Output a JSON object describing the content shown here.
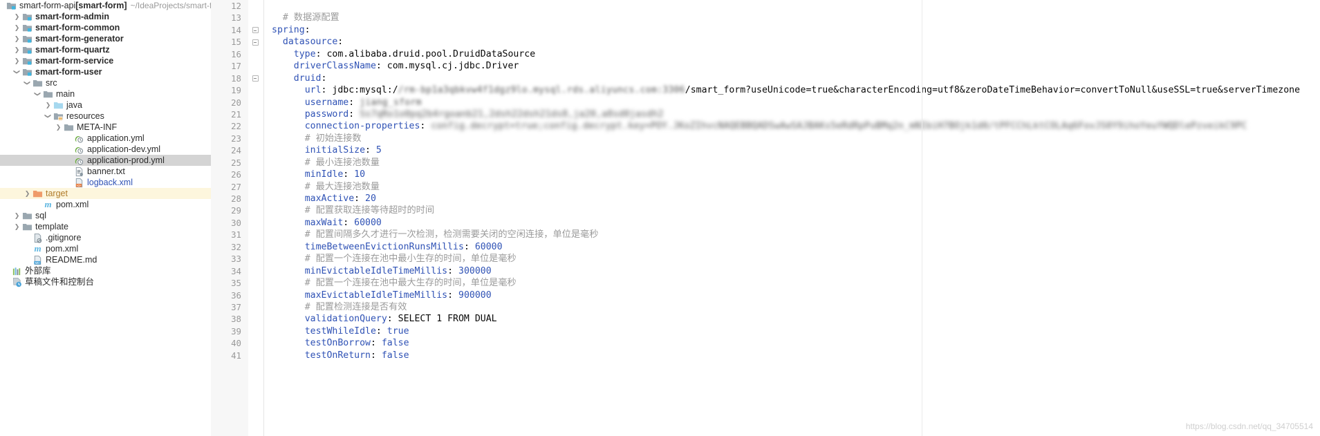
{
  "window": {
    "app": "IntelliJ IDEA",
    "active_file": "application-prod.yml"
  },
  "sidebar": {
    "root": {
      "name": "smart-form-api",
      "module": "[smart-form]",
      "path": "~/IdeaProjects/smart-form-"
    },
    "items": [
      {
        "label": "smart-form-admin",
        "indent": 1,
        "arrow": "collapsed",
        "icon": "module-folder-icon",
        "style": "bold",
        "state": "normal"
      },
      {
        "label": "smart-form-common",
        "indent": 1,
        "arrow": "collapsed",
        "icon": "module-folder-icon",
        "style": "bold",
        "state": "normal"
      },
      {
        "label": "smart-form-generator",
        "indent": 1,
        "arrow": "collapsed",
        "icon": "module-folder-icon",
        "style": "bold",
        "state": "normal"
      },
      {
        "label": "smart-form-quartz",
        "indent": 1,
        "arrow": "collapsed",
        "icon": "module-folder-icon",
        "style": "bold",
        "state": "normal"
      },
      {
        "label": "smart-form-service",
        "indent": 1,
        "arrow": "collapsed",
        "icon": "module-folder-icon",
        "style": "bold",
        "state": "normal"
      },
      {
        "label": "smart-form-user",
        "indent": 1,
        "arrow": "expanded",
        "icon": "module-folder-icon",
        "style": "bold",
        "state": "normal"
      },
      {
        "label": "src",
        "indent": 2,
        "arrow": "expanded",
        "icon": "folder-icon",
        "style": "normal",
        "state": "normal"
      },
      {
        "label": "main",
        "indent": 3,
        "arrow": "expanded",
        "icon": "folder-icon",
        "style": "normal",
        "state": "normal"
      },
      {
        "label": "java",
        "indent": 4,
        "arrow": "collapsed",
        "icon": "source-folder-icon",
        "style": "normal",
        "state": "normal"
      },
      {
        "label": "resources",
        "indent": 4,
        "arrow": "expanded",
        "icon": "resource-folder-icon",
        "style": "normal",
        "state": "normal"
      },
      {
        "label": "META-INF",
        "indent": 5,
        "arrow": "collapsed",
        "icon": "folder-icon",
        "style": "normal",
        "state": "normal"
      },
      {
        "label": "application.yml",
        "indent": 6,
        "arrow": "none",
        "icon": "spring-yaml-icon",
        "style": "normal",
        "state": "normal"
      },
      {
        "label": "application-dev.yml",
        "indent": 6,
        "arrow": "none",
        "icon": "spring-yaml-icon",
        "style": "normal",
        "state": "normal"
      },
      {
        "label": "application-prod.yml",
        "indent": 6,
        "arrow": "none",
        "icon": "spring-yaml-icon",
        "style": "normal",
        "state": "selected"
      },
      {
        "label": "banner.txt",
        "indent": 6,
        "arrow": "none",
        "icon": "text-file-icon",
        "style": "normal",
        "state": "normal"
      },
      {
        "label": "logback.xml",
        "indent": 6,
        "arrow": "none",
        "icon": "xml-file-icon",
        "style": "link",
        "state": "normal"
      },
      {
        "label": "target",
        "indent": 2,
        "arrow": "collapsed",
        "icon": "excluded-folder-icon",
        "style": "orange",
        "state": "highlight"
      },
      {
        "label": "pom.xml",
        "indent": 3,
        "arrow": "none",
        "icon": "maven-icon",
        "style": "normal",
        "state": "normal"
      },
      {
        "label": "sql",
        "indent": 1,
        "arrow": "collapsed",
        "icon": "folder-icon",
        "style": "normal",
        "state": "normal"
      },
      {
        "label": "template",
        "indent": 1,
        "arrow": "collapsed",
        "icon": "folder-icon",
        "style": "normal",
        "state": "normal"
      },
      {
        "label": ".gitignore",
        "indent": 2,
        "arrow": "none",
        "icon": "gitignore-icon",
        "style": "normal",
        "state": "normal"
      },
      {
        "label": "pom.xml",
        "indent": 2,
        "arrow": "none",
        "icon": "maven-icon",
        "style": "normal",
        "state": "normal"
      },
      {
        "label": "README.md",
        "indent": 2,
        "arrow": "none",
        "icon": "markdown-icon",
        "style": "normal",
        "state": "normal"
      },
      {
        "label": "外部库",
        "indent": 0,
        "arrow": "none",
        "icon": "external-libraries-icon",
        "style": "normal",
        "state": "normal"
      },
      {
        "label": "草稿文件和控制台",
        "indent": 0,
        "arrow": "none",
        "icon": "scratches-icon",
        "style": "normal",
        "state": "normal"
      }
    ]
  },
  "editor": {
    "watermark": "https://blog.csdn.net/qq_34705514",
    "lines": [
      {
        "n": "12",
        "fold": false,
        "indent": 0,
        "tokens": []
      },
      {
        "n": "13",
        "fold": false,
        "indent": 1,
        "tokens": [
          {
            "t": "comment",
            "v": "# 数据源配置"
          }
        ]
      },
      {
        "n": "14",
        "fold": true,
        "indent": 0,
        "tokens": [
          {
            "t": "key",
            "v": "spring"
          },
          {
            "t": "plain",
            "v": ":"
          }
        ]
      },
      {
        "n": "15",
        "fold": true,
        "indent": 1,
        "tokens": [
          {
            "t": "key",
            "v": "datasource"
          },
          {
            "t": "plain",
            "v": ":"
          }
        ]
      },
      {
        "n": "16",
        "fold": false,
        "indent": 2,
        "tokens": [
          {
            "t": "key",
            "v": "type"
          },
          {
            "t": "plain",
            "v": ": com.alibaba.druid.pool.DruidDataSource"
          }
        ]
      },
      {
        "n": "17",
        "fold": false,
        "indent": 2,
        "tokens": [
          {
            "t": "key",
            "v": "driverClassName"
          },
          {
            "t": "plain",
            "v": ": com.mysql.cj.jdbc.Driver"
          }
        ]
      },
      {
        "n": "18",
        "fold": true,
        "indent": 2,
        "tokens": [
          {
            "t": "key",
            "v": "druid"
          },
          {
            "t": "plain",
            "v": ":"
          }
        ]
      },
      {
        "n": "19",
        "fold": false,
        "indent": 3,
        "tokens": [
          {
            "t": "key",
            "v": "url"
          },
          {
            "t": "plain",
            "v": ": jdbc:mysql:/"
          },
          {
            "t": "blur",
            "v": "/rm-bp1a3qbkvw4f1dgz9lo.mysql.rds.aliyuncs.com:3306"
          },
          {
            "t": "plain",
            "v": "/smart_form?useUnicode=true&characterEncoding=utf8&zeroDateTimeBehavior=convertToNull&useSSL=true&serverTimezone"
          }
        ]
      },
      {
        "n": "20",
        "fold": false,
        "indent": 3,
        "tokens": [
          {
            "t": "key",
            "v": "username"
          },
          {
            "t": "plain",
            "v": ": "
          },
          {
            "t": "blur",
            "v": "jiang_sform"
          }
        ]
      },
      {
        "n": "21",
        "fold": false,
        "indent": 3,
        "tokens": [
          {
            "t": "key",
            "v": "password"
          },
          {
            "t": "plain",
            "v": ": "
          },
          {
            "t": "blur2",
            "v": "Ss7qRo1o0pq2b4rgoanb21,2dsh22dsh21ds8,ja20,a8sd0jasdh2"
          }
        ]
      },
      {
        "n": "22",
        "fold": false,
        "indent": 3,
        "tokens": [
          {
            "t": "key",
            "v": "connection-properties"
          },
          {
            "t": "plain",
            "v": ": "
          },
          {
            "t": "blur2",
            "v": "config.decrypt=true;config.decrypt.key=POY.JKoZIhvcNAQEBBQADSwAwSAJBAKs5eRdRpPuBMq2n_mNIbiH7BOjk1d0/tPFCChLktCOLAq6FovJS0Y9ihoYeuYWQDlePzveikC9PC"
          }
        ]
      },
      {
        "n": "23",
        "fold": false,
        "indent": 3,
        "tokens": [
          {
            "t": "comment",
            "v": "# 初始连接数"
          }
        ]
      },
      {
        "n": "24",
        "fold": false,
        "indent": 3,
        "tokens": [
          {
            "t": "key",
            "v": "initialSize"
          },
          {
            "t": "plain",
            "v": ": "
          },
          {
            "t": "number",
            "v": "5"
          }
        ]
      },
      {
        "n": "25",
        "fold": false,
        "indent": 3,
        "tokens": [
          {
            "t": "comment",
            "v": "# 最小连接池数量"
          }
        ]
      },
      {
        "n": "26",
        "fold": false,
        "indent": 3,
        "tokens": [
          {
            "t": "key",
            "v": "minIdle"
          },
          {
            "t": "plain",
            "v": ": "
          },
          {
            "t": "number",
            "v": "10"
          }
        ]
      },
      {
        "n": "27",
        "fold": false,
        "indent": 3,
        "tokens": [
          {
            "t": "comment",
            "v": "# 最大连接池数量"
          }
        ]
      },
      {
        "n": "28",
        "fold": false,
        "indent": 3,
        "tokens": [
          {
            "t": "key",
            "v": "maxActive"
          },
          {
            "t": "plain",
            "v": ": "
          },
          {
            "t": "number",
            "v": "20"
          }
        ]
      },
      {
        "n": "29",
        "fold": false,
        "indent": 3,
        "tokens": [
          {
            "t": "comment",
            "v": "# 配置获取连接等待超时的时间"
          }
        ]
      },
      {
        "n": "30",
        "fold": false,
        "indent": 3,
        "tokens": [
          {
            "t": "key",
            "v": "maxWait"
          },
          {
            "t": "plain",
            "v": ": "
          },
          {
            "t": "number",
            "v": "60000"
          }
        ]
      },
      {
        "n": "31",
        "fold": false,
        "indent": 3,
        "tokens": [
          {
            "t": "comment",
            "v": "# 配置间隔多久才进行一次检测，检测需要关闭的空闲连接，单位是毫秒"
          }
        ]
      },
      {
        "n": "32",
        "fold": false,
        "indent": 3,
        "tokens": [
          {
            "t": "key",
            "v": "timeBetweenEvictionRunsMillis"
          },
          {
            "t": "plain",
            "v": ": "
          },
          {
            "t": "number",
            "v": "60000"
          }
        ]
      },
      {
        "n": "33",
        "fold": false,
        "indent": 3,
        "tokens": [
          {
            "t": "comment",
            "v": "# 配置一个连接在池中最小生存的时间，单位是毫秒"
          }
        ]
      },
      {
        "n": "34",
        "fold": false,
        "indent": 3,
        "tokens": [
          {
            "t": "key",
            "v": "minEvictableIdleTimeMillis"
          },
          {
            "t": "plain",
            "v": ": "
          },
          {
            "t": "number",
            "v": "300000"
          }
        ]
      },
      {
        "n": "35",
        "fold": false,
        "indent": 3,
        "tokens": [
          {
            "t": "comment",
            "v": "# 配置一个连接在池中最大生存的时间，单位是毫秒"
          }
        ]
      },
      {
        "n": "36",
        "fold": false,
        "indent": 3,
        "tokens": [
          {
            "t": "key",
            "v": "maxEvictableIdleTimeMillis"
          },
          {
            "t": "plain",
            "v": ": "
          },
          {
            "t": "number",
            "v": "900000"
          }
        ]
      },
      {
        "n": "37",
        "fold": false,
        "indent": 3,
        "tokens": [
          {
            "t": "comment",
            "v": "# 配置检测连接是否有效"
          }
        ]
      },
      {
        "n": "38",
        "fold": false,
        "indent": 3,
        "tokens": [
          {
            "t": "key",
            "v": "validationQuery"
          },
          {
            "t": "plain",
            "v": ": SELECT 1 FROM DUAL"
          }
        ]
      },
      {
        "n": "39",
        "fold": false,
        "indent": 3,
        "tokens": [
          {
            "t": "key",
            "v": "testWhileIdle"
          },
          {
            "t": "plain",
            "v": ": "
          },
          {
            "t": "number",
            "v": "true"
          }
        ]
      },
      {
        "n": "40",
        "fold": false,
        "indent": 3,
        "tokens": [
          {
            "t": "key",
            "v": "testOnBorrow"
          },
          {
            "t": "plain",
            "v": ": "
          },
          {
            "t": "number",
            "v": "false"
          }
        ]
      },
      {
        "n": "41",
        "fold": false,
        "indent": 3,
        "tokens": [
          {
            "t": "key",
            "v": "testOnReturn"
          },
          {
            "t": "plain",
            "v": ": "
          },
          {
            "t": "number",
            "v": "false"
          }
        ]
      }
    ]
  },
  "colors": {
    "key": "#2f52b5",
    "comment": "#9b9b9b",
    "selection": "#d4d4d4",
    "highlight": "#fdf6dd",
    "gutter": "#f7f7f7"
  }
}
